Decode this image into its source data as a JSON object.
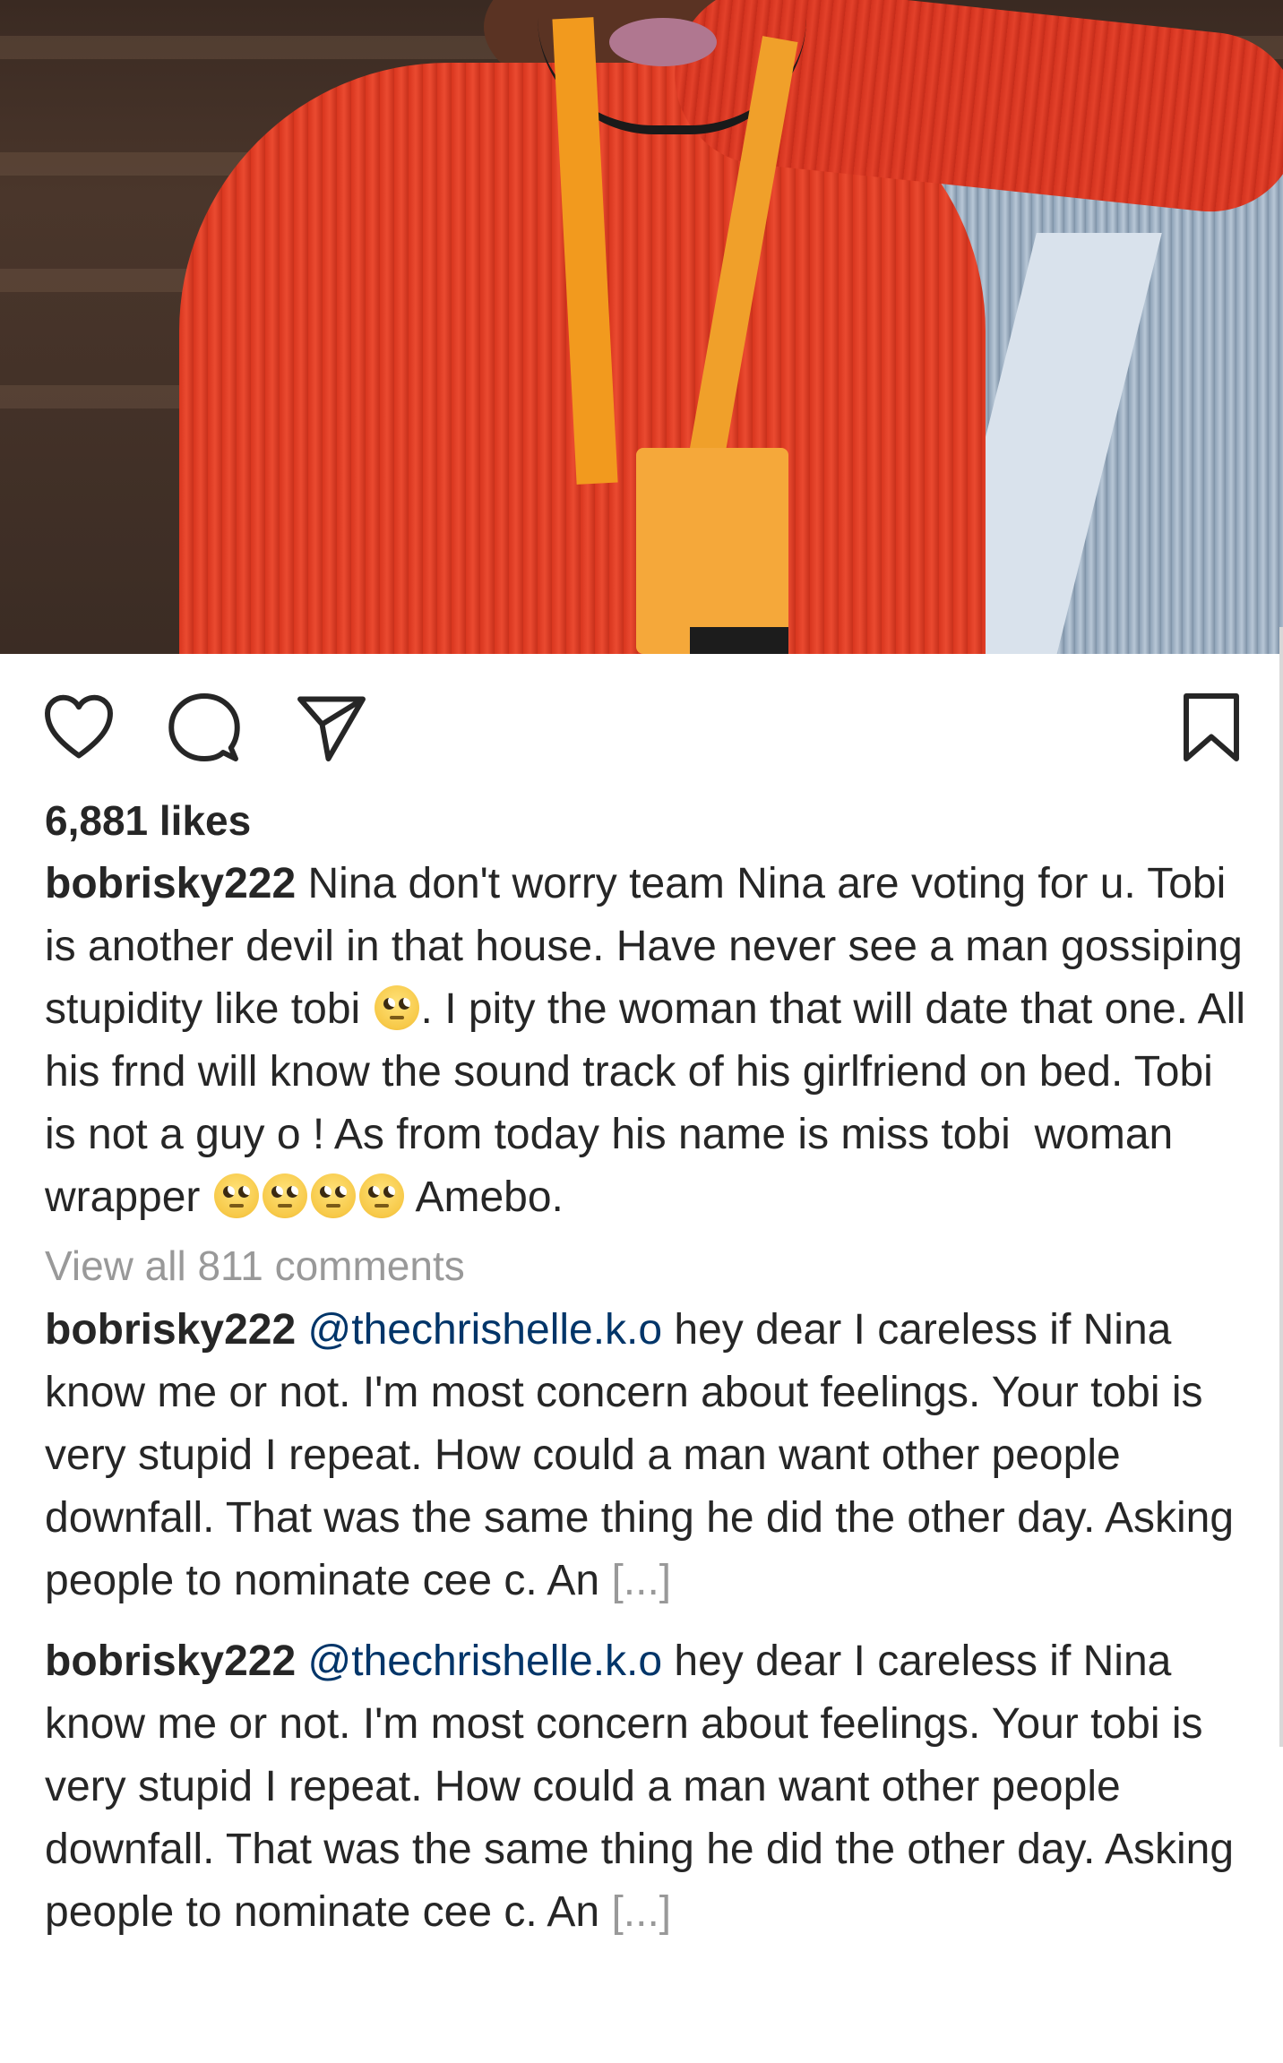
{
  "post": {
    "likes": "6,881 likes",
    "caption": {
      "username": "bobrisky222",
      "text_part1": " Nina don't worry team Nina are voting for u. Tobi is another devil in that house. Have never see a man gossiping stupidity like tobi ",
      "text_part2": ". I pity the woman that will date that one. All his frnd will know the sound track of his girlfriend on bed. Tobi is not a guy o ! As from today his name is miss tobi  woman wrapper ",
      "text_part3": " Amebo."
    },
    "emoji_name": "face-with-rolling-eyes",
    "view_all_comments": "View all 811 comments"
  },
  "comments": [
    {
      "username": "bobrisky222",
      "mention": "@thechrishelle.k.o",
      "text": " hey dear I careless if Nina know me or not. I'm most concern about feelings. Your tobi is very stupid I repeat. How could a man want other people downfall. That was the same thing he did the other day. Asking people to nominate cee c. An ",
      "more": "[...]"
    },
    {
      "username": "bobrisky222",
      "mention": "@thechrishelle.k.o",
      "text": " hey dear I careless if Nina know me or not. I'm most concern about feelings. Your tobi is very stupid I repeat. How could a man want other people downfall. That was the same thing he did the other day. Asking people to nominate cee c. An ",
      "more": "[...]"
    }
  ],
  "icons": {
    "like": "heart-icon",
    "comment": "comment-bubble-icon",
    "share": "paper-plane-icon",
    "save": "bookmark-icon"
  },
  "colors": {
    "text": "#262626",
    "muted": "#999999",
    "mention": "#003569",
    "shirt_red": "#d9361f",
    "lanyard_orange": "#f29a1e"
  }
}
